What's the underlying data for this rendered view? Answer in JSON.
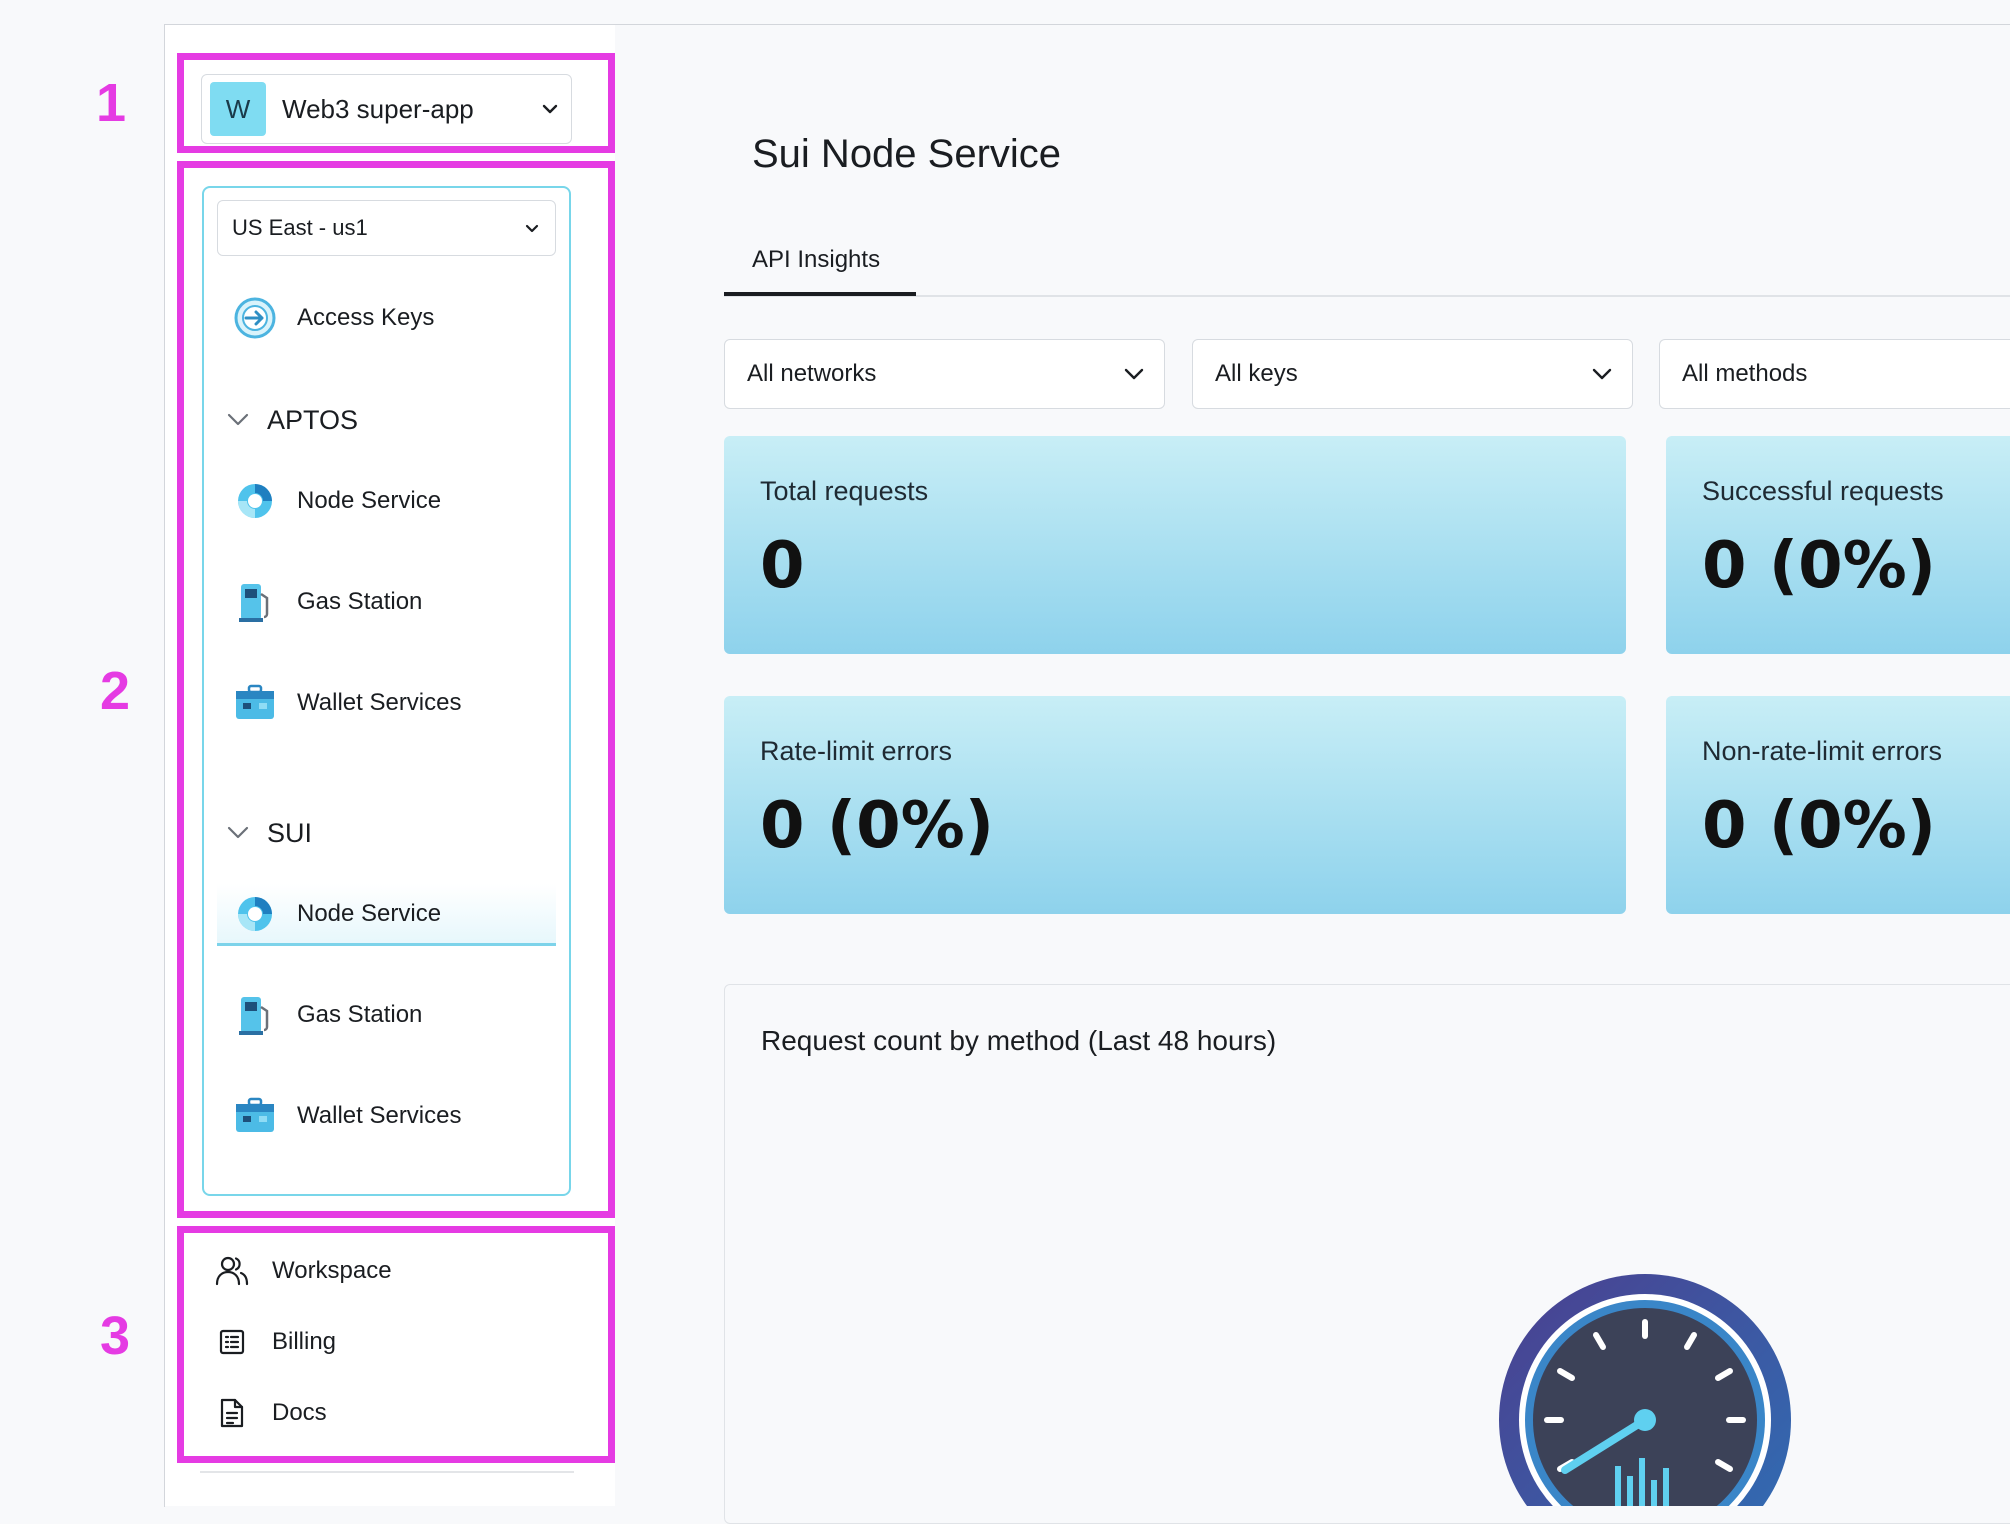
{
  "annotations": [
    "1",
    "2",
    "3"
  ],
  "workspace": {
    "avatar_letter": "W",
    "name": "Web3 super-app"
  },
  "region": {
    "selected": "US East - us1"
  },
  "nav": {
    "access_keys": "Access Keys",
    "groups": [
      {
        "label": "APTOS",
        "items": [
          "Node Service",
          "Gas Station",
          "Wallet Services"
        ]
      },
      {
        "label": "SUI",
        "items": [
          "Node Service",
          "Gas Station",
          "Wallet Services"
        ],
        "active_item": "Node Service"
      }
    ]
  },
  "footer_links": [
    "Workspace",
    "Billing",
    "Docs"
  ],
  "main": {
    "title": "Sui Node Service",
    "tabs": [
      "API Insights"
    ],
    "filters": [
      "All networks",
      "All keys",
      "All methods"
    ],
    "cards": [
      {
        "title": "Total requests",
        "value": "0"
      },
      {
        "title": "Successful requests",
        "value": "0 (0%)"
      },
      {
        "title": "Rate-limit errors",
        "value": "0 (0%)"
      },
      {
        "title": "Non-rate-limit errors",
        "value": "0 (0%)"
      }
    ],
    "chart_title": "Request count by method (Last 48 hours)"
  },
  "colors": {
    "highlight": "#e53be3",
    "accent": "#78d6ea",
    "card_gradient_end": "#8ed2ec"
  }
}
